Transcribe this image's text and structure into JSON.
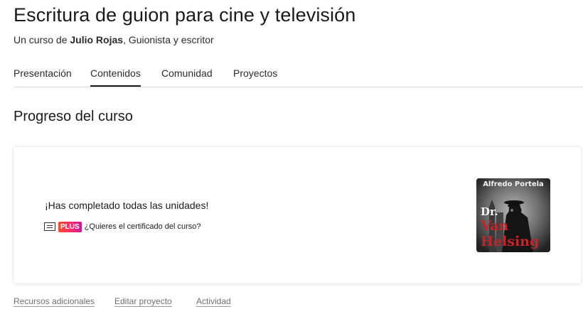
{
  "course": {
    "title": "Escritura de guion para cine y televisión",
    "byline_prefix": "Un curso de",
    "author": "Julio Rojas",
    "author_role": ", Guionista y escritor"
  },
  "tabs": [
    {
      "label": "Presentación",
      "active": false
    },
    {
      "label": "Contenidos",
      "active": true
    },
    {
      "label": "Comunidad",
      "active": false
    },
    {
      "label": "Proyectos",
      "active": false
    }
  ],
  "progress": {
    "section_title": "Progreso del curso",
    "completed_message": "¡Has completado todas las unidades!",
    "plus_badge": "PLUS",
    "certificate_link": "¿Quieres el certificado del curso?",
    "thumbnail": {
      "author_text": "Alfredo Portela",
      "title_lines": [
        "Dr.",
        "Van",
        "Helsing"
      ]
    }
  },
  "footer": {
    "links": [
      "Recursos adicionales",
      "Editar proyecto",
      "Actividad"
    ]
  },
  "colors": {
    "plus_gradient_start": "#ff4b2b",
    "plus_gradient_end": "#c3199a",
    "thumbnail_title_red": "#c0262a",
    "tab_underline": "#1a1a1a"
  },
  "icons": {
    "certificate": "certificate-icon"
  }
}
